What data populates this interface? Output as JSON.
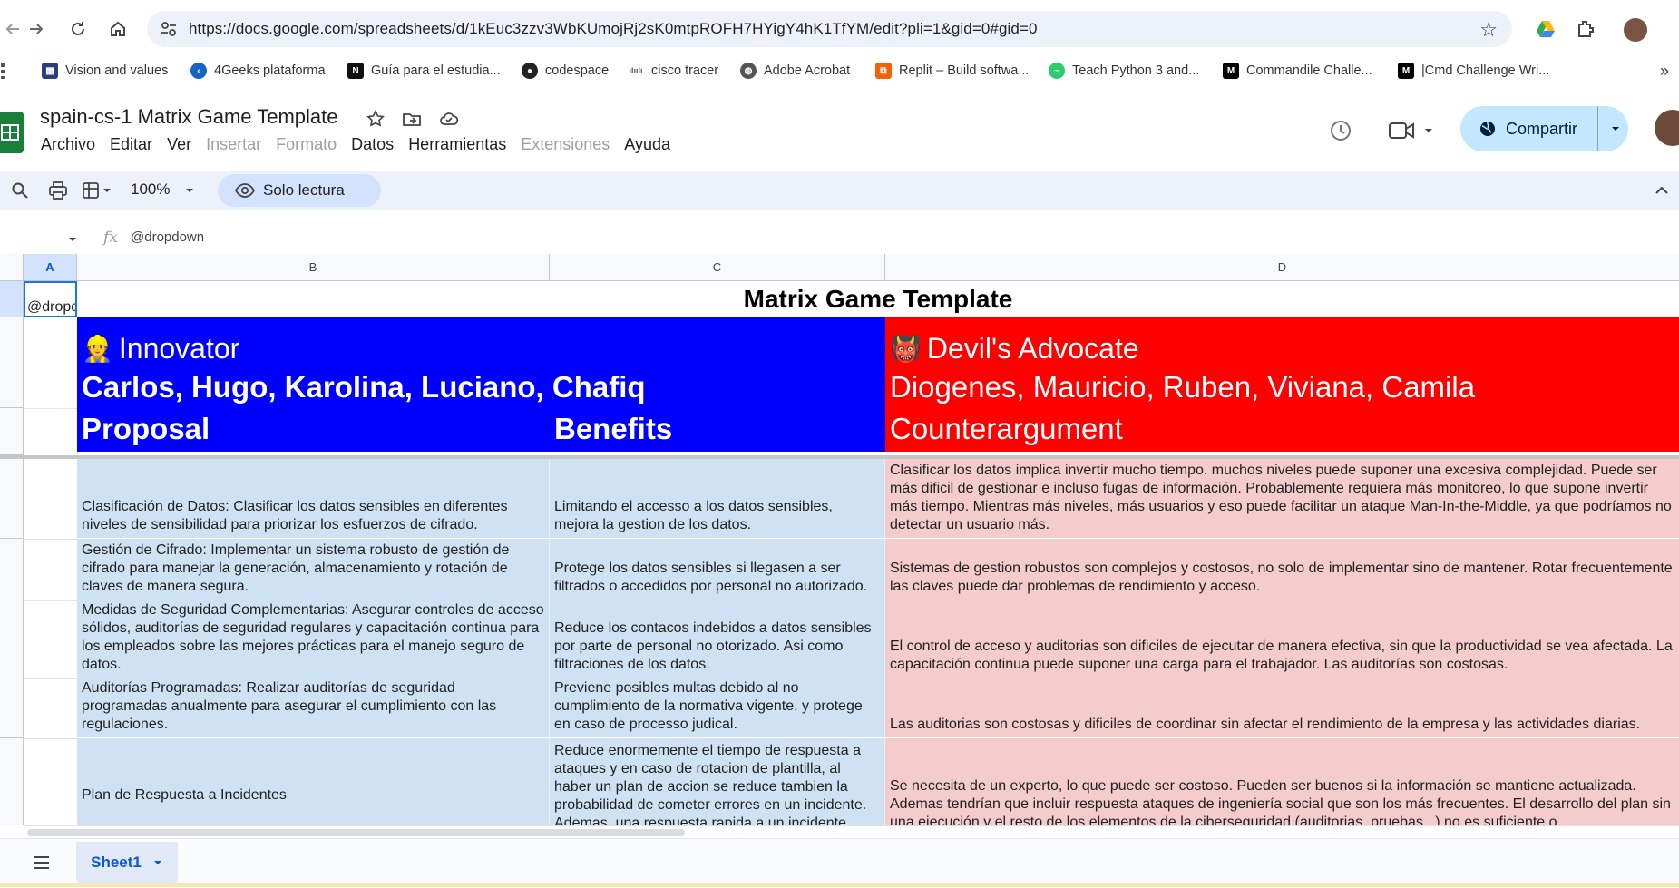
{
  "browser": {
    "url": "https://docs.google.com/spreadsheets/d/1kEuc3zzv3WbKUmojRj2sK0mtpROFH7HYigY4hK1TfYM/edit?pli=1&gid=0#gid=0",
    "bookmarks": [
      {
        "label": "Vision and values",
        "icon": "building-icon"
      },
      {
        "label": "4Geeks plataforma",
        "icon": "4geeks-icon"
      },
      {
        "label": "Guía para el estudia...",
        "icon": "notion-icon"
      },
      {
        "label": "codespace",
        "icon": "github-icon"
      },
      {
        "label": "cisco tracer",
        "icon": "cisco-icon"
      },
      {
        "label": "Adobe Acrobat",
        "icon": "globe-icon"
      },
      {
        "label": "Replit – Build softwa...",
        "icon": "replit-icon"
      },
      {
        "label": "Teach Python 3 and...",
        "icon": "python-icon"
      },
      {
        "label": "Commandile Challe...",
        "icon": "medium-icon"
      },
      {
        "label": "|Cmd Challenge Wri...",
        "icon": "medium-icon"
      }
    ]
  },
  "app": {
    "title": "spain-cs-1 Matrix Game Template",
    "menu": [
      {
        "label": "Archivo",
        "enabled": true
      },
      {
        "label": "Editar",
        "enabled": true
      },
      {
        "label": "Ver",
        "enabled": true
      },
      {
        "label": "Insertar",
        "enabled": false
      },
      {
        "label": "Formato",
        "enabled": false
      },
      {
        "label": "Datos",
        "enabled": true
      },
      {
        "label": "Herramientas",
        "enabled": true
      },
      {
        "label": "Extensiones",
        "enabled": false
      },
      {
        "label": "Ayuda",
        "enabled": true
      }
    ],
    "share_label": "Compartir",
    "brand_color": "#188038",
    "accent_color": "#c2e7ff"
  },
  "toolbar": {
    "zoom": "100%",
    "mode_label": "Solo lectura"
  },
  "formula_bar": {
    "fx": "fx",
    "content": "@dropdown"
  },
  "grid": {
    "columns": [
      "A",
      "B",
      "C",
      "D"
    ],
    "selected_column": "A",
    "a1_value": "@dropdown",
    "title": "Matrix Game Template",
    "innovator": {
      "emoji": "👷",
      "label": "Innovator",
      "members": "Carlos, Hugo, Karolina, Luciano, Chafiq",
      "color": "#0000ff"
    },
    "devil": {
      "emoji": "👹",
      "label": "Devil's Advocate",
      "members": "Diogenes, Mauricio, Ruben, Viviana, Camila",
      "color": "#ff0000"
    },
    "headers": {
      "proposal": "Proposal",
      "benefits": "Benefits",
      "counterargument": "Counterargument"
    },
    "rows": [
      {
        "proposal": "Clasificación de Datos: Clasificar los datos sensibles en diferentes niveles de sensibilidad para priorizar los esfuerzos de cifrado.",
        "benefits": "Limitando el accesso a los datos sensibles, mejora la gestion de los datos.",
        "counter": "Clasificar los datos implica invertir mucho tiempo. muchos niveles puede suponer una excesiva complejidad. Puede ser más dificil de gestionar e incluso fugas de información. Probablemente requiera más monitoreo, lo que supone invertir más tiempo. Mientras más niveles, más usuarios y eso puede facilitar un ataque Man-In-the-Middle, ya que podríamos no detectar un usuario más."
      },
      {
        "proposal": "Gestión de Cifrado: Implementar un sistema robusto de gestión de cifrado para manejar la generación, almacenamiento y rotación de claves de manera segura.",
        "benefits": "Protege los datos sensibles si llegasen a ser filtrados o accedidos por personal no autorizado.",
        "counter": "Sistemas de gestion robustos son complejos y costosos, no solo de implementar sino de mantener. Rotar frecuentemente las claves puede dar problemas de rendimiento y acceso."
      },
      {
        "proposal": "Medidas de Seguridad Complementarias: Asegurar controles de acceso sólidos, auditorías de seguridad regulares y capacitación continua para los empleados sobre las mejores prácticas para el manejo seguro de datos.",
        "benefits": "Reduce los contacos indebidos a datos sensibles por parte de personal no otorizado. Asi como filtraciones de los datos.",
        "counter": "El control de acceso y auditorias son dificiles de ejecutar de manera efectiva, sin que la productividad se vea afectada. La capacitación continua puede suponer una carga para el trabajador. Las auditorías son costosas."
      },
      {
        "proposal": "Auditorías Programadas: Realizar auditorías de seguridad programadas anualmente para asegurar el cumplimiento con las regulaciones.",
        "benefits": "Previene posibles multas debido al no cumplimiento de la normativa vigente, y protege en caso de processo judical.",
        "counter": "Las auditorias son costosas y dificiles de coordinar sin afectar el rendimiento de la empresa y las actividades diarias."
      },
      {
        "proposal": "Plan de Respuesta a Incidentes",
        "benefits": "Reduce enormemente el tiempo de respuesta a ataques y en caso de rotacion de plantilla, al haber un plan de accion se reduce tambien la probabilidad de cometer errores en un incidente. Ademas, una respuesta rapida a un incidente",
        "counter": "Se necesita de un experto, lo que puede ser costoso. Pueden ser buenos si la información se mantiene actualizada. Ademas tendrían que incluir respuesta ataques de ingeniería social que son los más frecuentes. El desarrollo del plan sin una ejecución y el resto de los elementos de la ciberseguridad (auditorias, pruebas...) no es suficiente o"
      }
    ]
  },
  "sheets": {
    "active_tab": "Sheet1"
  }
}
